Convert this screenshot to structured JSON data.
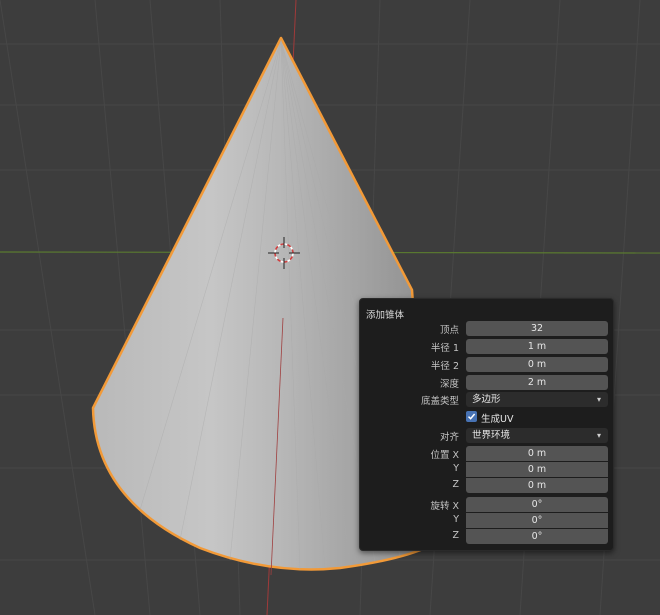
{
  "viewport": {
    "object": "cone",
    "selection_outline_color": "#f29a38"
  },
  "panel": {
    "title": "添加锥体",
    "vertices": {
      "label": "顶点",
      "value": "32"
    },
    "radius1": {
      "label": "半径 1",
      "value": "1 m"
    },
    "radius2": {
      "label": "半径 2",
      "value": "0 m"
    },
    "depth": {
      "label": "深度",
      "value": "2 m"
    },
    "base_fill_type": {
      "label": "底盖类型",
      "value": "多边形"
    },
    "generate_uv": {
      "label": "生成UV",
      "checked": true
    },
    "align": {
      "label": "对齐",
      "value": "世界环境"
    },
    "location": {
      "label_x": "位置 X",
      "label_y": "Y",
      "label_z": "Z",
      "x": "0 m",
      "y": "0 m",
      "z": "0 m"
    },
    "rotation": {
      "label_x": "旋转 X",
      "label_y": "Y",
      "label_z": "Z",
      "x": "0°",
      "y": "0°",
      "z": "0°"
    },
    "accent_color": "#4772b3"
  }
}
